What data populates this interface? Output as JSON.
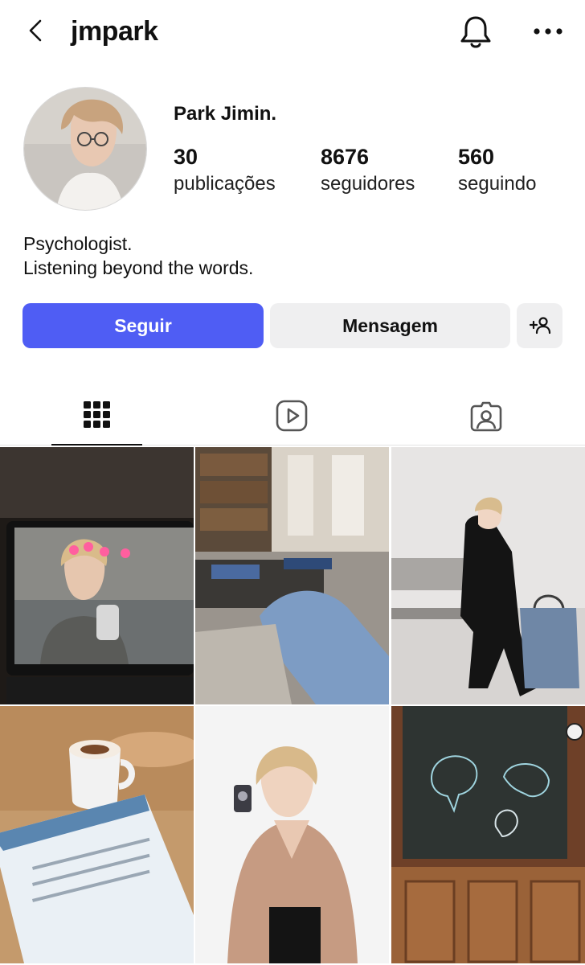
{
  "header": {
    "username": "jmpark"
  },
  "profile": {
    "display_name": "Park Jimin.",
    "stats": [
      {
        "value": "30",
        "label": "publicações"
      },
      {
        "value": "8676",
        "label": "seguidores"
      },
      {
        "value": "560",
        "label": "seguindo"
      }
    ],
    "bio": [
      "Psychologist.",
      "Listening beyond the words."
    ]
  },
  "actions": {
    "follow_label": "Seguir",
    "message_label": "Mensagem"
  },
  "tabs": [
    {
      "icon": "grid-icon",
      "active": true
    },
    {
      "icon": "reels-icon",
      "active": false
    },
    {
      "icon": "tagged-icon",
      "active": false
    }
  ],
  "posts": [
    {
      "subject": "laptop-selfie"
    },
    {
      "subject": "living-room"
    },
    {
      "subject": "suit-bench"
    },
    {
      "subject": "coffee-book"
    },
    {
      "subject": "beige-sweater"
    },
    {
      "subject": "blackboard-brain"
    }
  ],
  "colors": {
    "accent": "#4f5df4",
    "secondary_button": "#efeff0",
    "text": "#111111"
  }
}
